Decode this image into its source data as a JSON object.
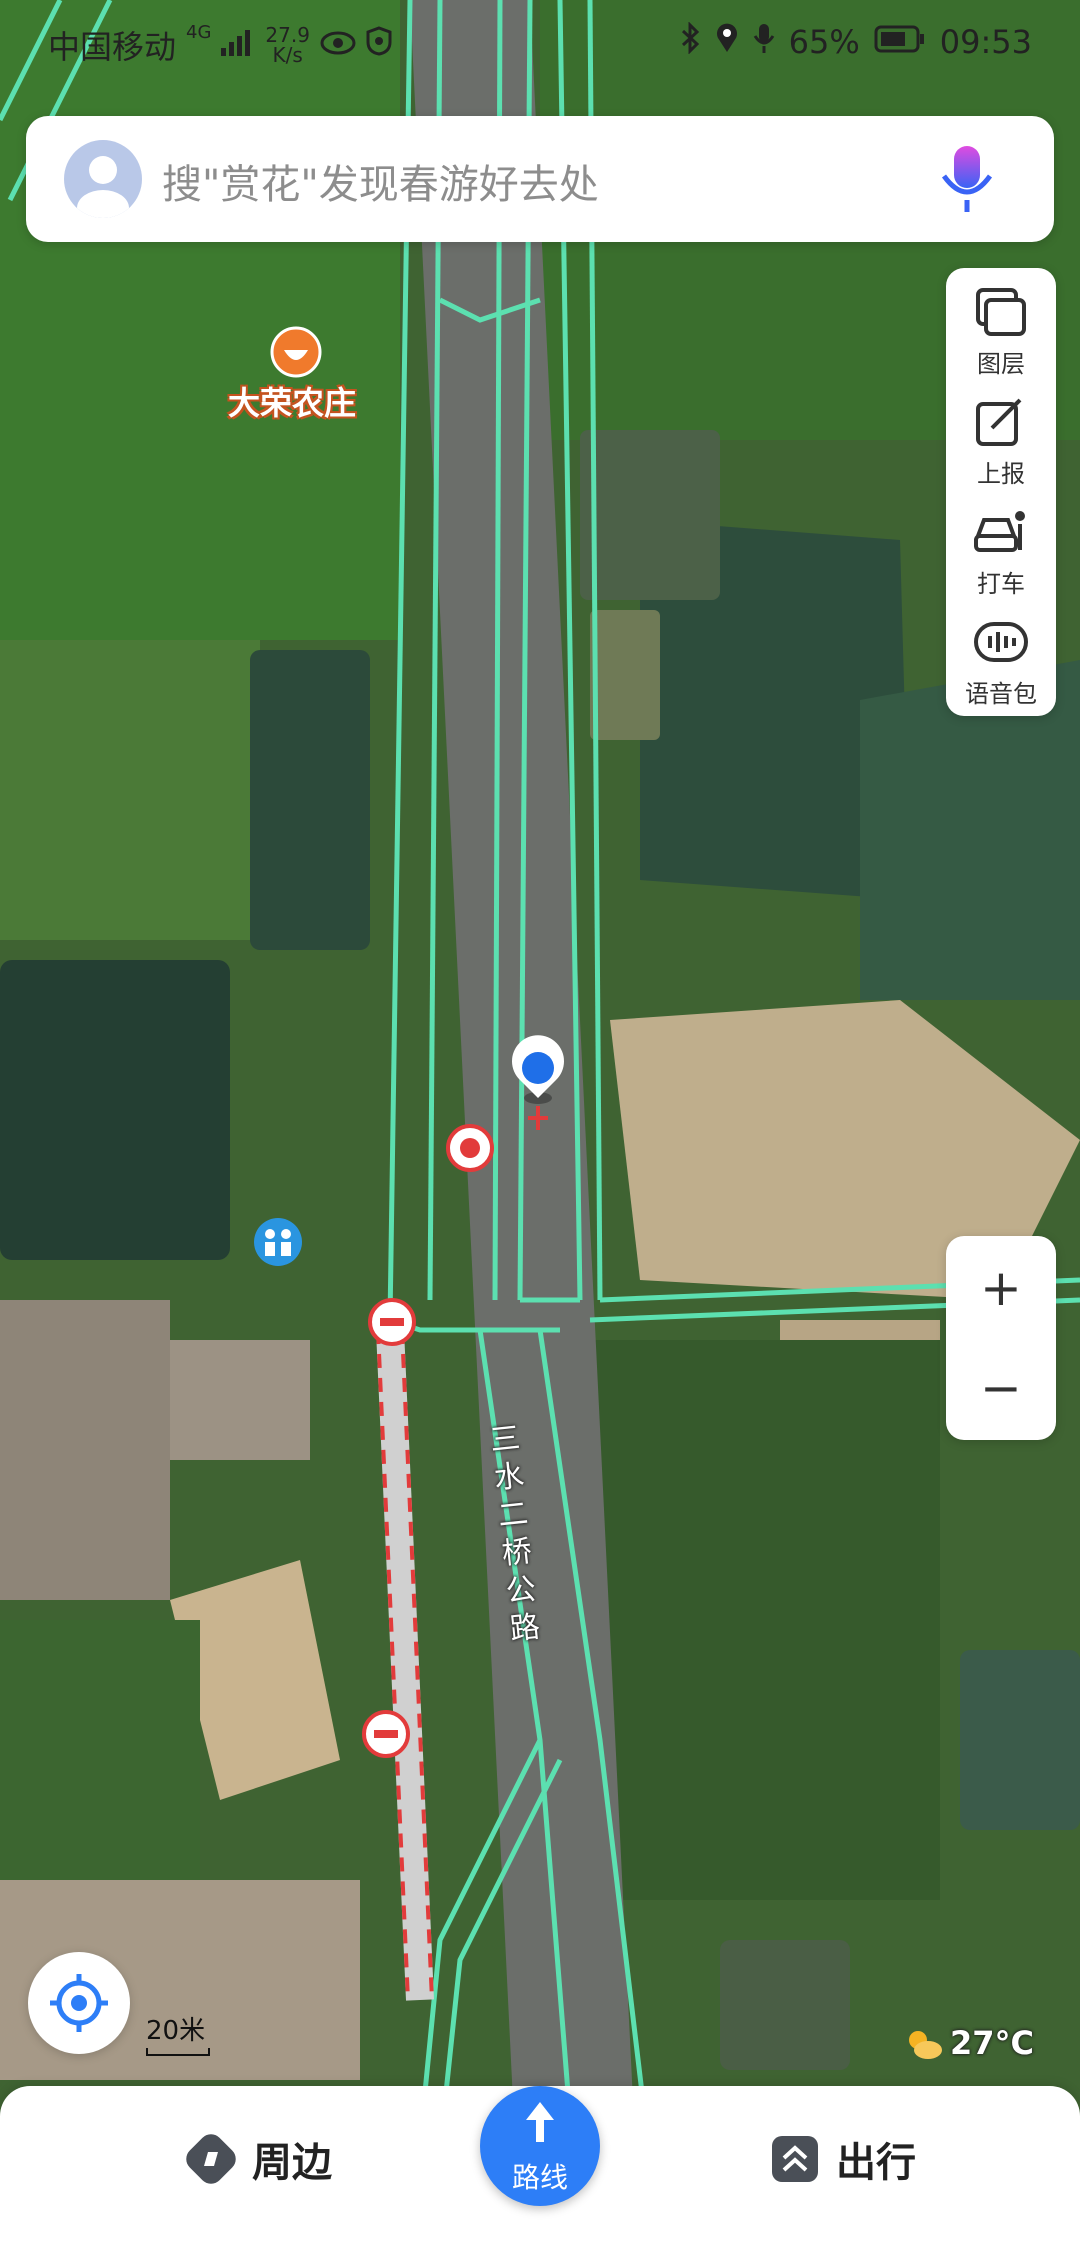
{
  "status_bar": {
    "carrier": "中国移动",
    "network": "4G",
    "speed_value": "27.9",
    "speed_unit": "K/s",
    "battery": "65%",
    "time": "09:53"
  },
  "search": {
    "placeholder": "搜\"赏花\"发现春游好去处"
  },
  "map_tools": [
    {
      "label": "图层",
      "icon": "layers-icon"
    },
    {
      "label": "上报",
      "icon": "report-icon"
    },
    {
      "label": "打车",
      "icon": "taxi-icon"
    },
    {
      "label": "语音包",
      "icon": "voice-pack-icon"
    }
  ],
  "zoom": {
    "in": "+",
    "out": "−"
  },
  "poi": {
    "name": "大荣农庄"
  },
  "road": {
    "name": "三水二桥公路"
  },
  "scale": {
    "label": "20米"
  },
  "weather": {
    "temp": "27°C"
  },
  "bottom_nav": {
    "nearby": "周边",
    "route": "路线",
    "travel": "出行"
  },
  "colors": {
    "accent": "#2d7ef7",
    "road_outline": "#5ce0b0",
    "closure": "#e23b3b"
  }
}
